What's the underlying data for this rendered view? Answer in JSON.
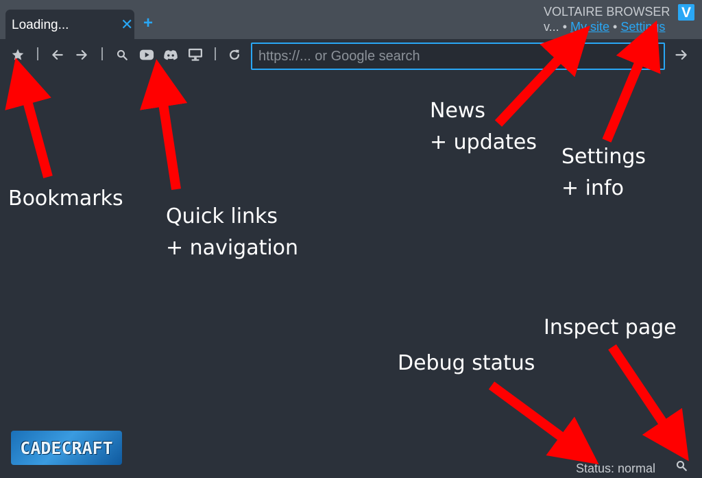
{
  "tabs": [
    {
      "title": "Loading...",
      "close_label": "✕"
    }
  ],
  "new_tab_label": "+",
  "brand": {
    "name": "VOLTAIRE BROWSER",
    "logo_letter": "V",
    "version": "v...",
    "sep1": "•",
    "my_site_label": "My site",
    "sep2": "•",
    "settings_label": "Settings"
  },
  "toolbar": {
    "icons": [
      "star-icon",
      "arrow-left-icon",
      "arrow-right-icon",
      "search-icon",
      "youtube-icon",
      "discord-icon",
      "desktop-icon",
      "reload-icon",
      "go-arrow-icon"
    ],
    "url_placeholder": "https://... or Google search",
    "url_value": ""
  },
  "annotations": {
    "bookmarks": "Bookmarks",
    "quick_links_1": "Quick links",
    "quick_links_2": "+ navigation",
    "news_1": "News",
    "news_2": "+ updates",
    "settings_1": "Settings",
    "settings_2": "+ info",
    "inspect": "Inspect page",
    "debug": "Debug status"
  },
  "footer": {
    "logo_text": "CADECRAFT",
    "status": "Status: normal"
  },
  "colors": {
    "accent": "#29a7f5",
    "background": "#2b313a",
    "titlebar": "#474e57",
    "arrow": "#ff0000"
  }
}
